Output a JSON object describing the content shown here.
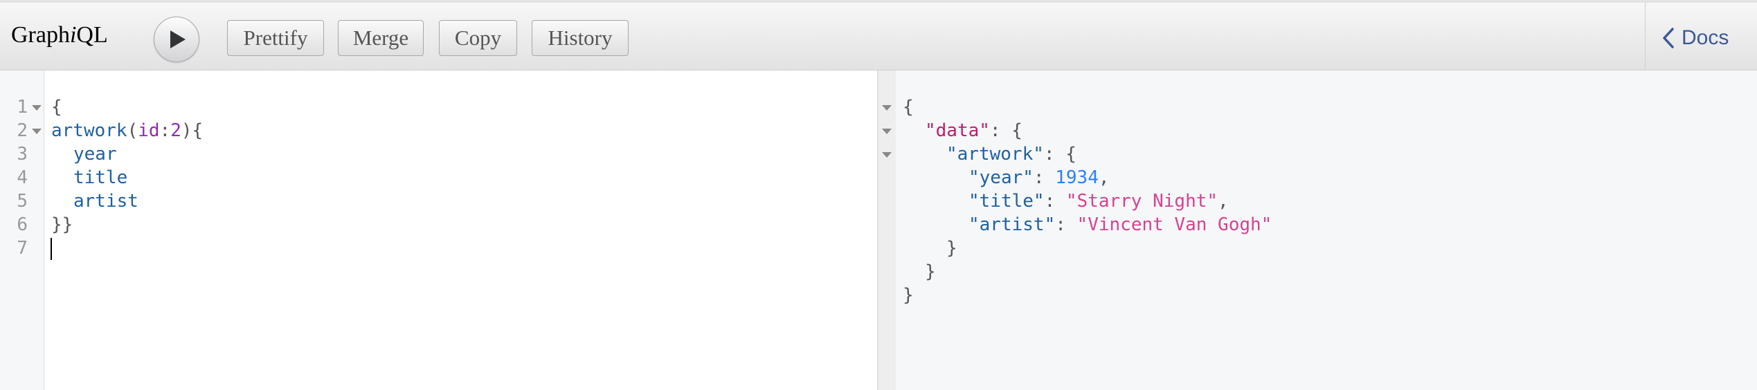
{
  "app": {
    "logo_pre": "Graph",
    "logo_i": "i",
    "logo_post": "QL"
  },
  "toolbar": {
    "execute_icon": "play-icon",
    "buttons": [
      "Prettify",
      "Merge",
      "Copy",
      "History"
    ],
    "docs_label": "Docs",
    "docs_icon": "chevron-left-icon"
  },
  "query_editor": {
    "line_numbers": [
      "1",
      "2",
      "3",
      "4",
      "5",
      "6",
      "7"
    ],
    "l1": "{",
    "l2_field": "artwork",
    "l2_open": "(",
    "l2_arg": "id",
    "l2_colon": ":",
    "l2_val": "2",
    "l2_close": "){",
    "l3": "year",
    "l4": "title",
    "l5": "artist",
    "l6": "}}"
  },
  "result": {
    "open": "{",
    "data_key": "\"data\"",
    "data_sep": ": {",
    "artwork_key": "\"artwork\"",
    "artwork_sep": ": {",
    "year_key": "\"year\"",
    "year_val": "1934",
    "title_key": "\"title\"",
    "title_val": "\"Starry Night\"",
    "artist_key": "\"artist\"",
    "artist_val": "\"Vincent Van Gogh\"",
    "colon": ": ",
    "comma": ",",
    "close": "}"
  },
  "colors": {
    "field": "#1f61a0",
    "argument": "#8b2bb9",
    "number": "#2882f9",
    "string": "#d64292",
    "data_key": "#c41a6c",
    "docs_link": "#3b5998"
  }
}
